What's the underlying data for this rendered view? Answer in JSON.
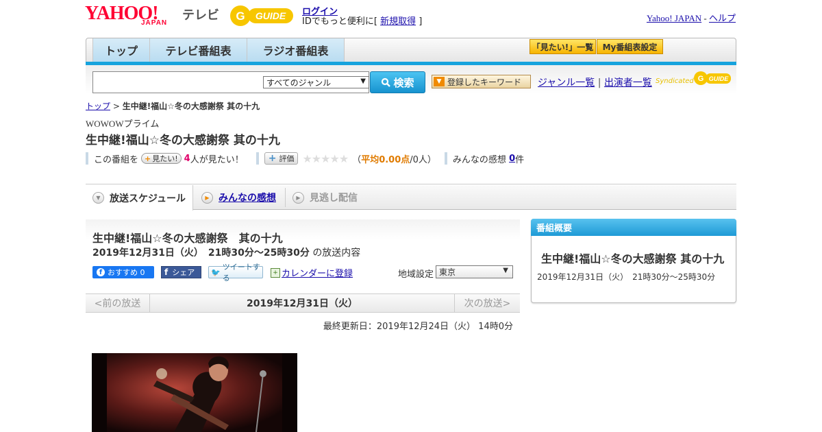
{
  "header": {
    "logo_text": "YAHOO!",
    "logo_sub": "JAPAN",
    "service_name": "テレビ",
    "guide_logo": "G-GUIDE",
    "login_label": "ログイン",
    "login_sub_prefix": "IDでもっと便利に[",
    "signup_label": "新規取得",
    "login_sub_suffix": "]",
    "yahoo_japan_link": "Yahoo! JAPAN",
    "separator": " - ",
    "help_link": "ヘルプ"
  },
  "nav": {
    "tabs": [
      "トップ",
      "テレビ番組表",
      "ラジオ番組表"
    ],
    "buttons": [
      "「見たい!」一覧",
      "My番組表設定"
    ]
  },
  "search": {
    "query_value": "",
    "genre_selected": "すべてのジャンル",
    "search_button": "検索",
    "keyword_button": "登録したキーワード",
    "genre_list_link": "ジャンル一覧",
    "link_separator": " | ",
    "performer_list_link": "出演者一覧",
    "syndicated_label": "Syndicated"
  },
  "breadcrumb": {
    "home": "トップ",
    "separator": " > ",
    "current": "生中継!福山☆冬の大感謝祭 其の十九"
  },
  "program": {
    "channel": "WOWOWプライム",
    "title": "生中継!福山☆冬の大感謝祭 其の十九",
    "stats": {
      "this_program_label": "この番組を",
      "mitai_button": "見たい!",
      "mitai_count": "4",
      "mitai_suffix": "人が見たい！",
      "hyoka_button": "評価",
      "stars": "★★★★★",
      "rating_open": "（",
      "rating_avg": "平均0.00点",
      "rating_people": "/0人）",
      "kansou_label": "みんなの感想",
      "kansou_count": "0",
      "kansou_unit": "件"
    }
  },
  "tabs": [
    "放送スケジュール",
    "みんなの感想",
    "見逃し配信"
  ],
  "main": {
    "title": "生中継!福山☆冬の大感謝祭　其の十九",
    "date": "2019年12月31日（火）　21時30分～25時30分",
    "date_suffix": "の放送内容",
    "fb_button": "おすすめ 0",
    "share_button": "シェア",
    "tweet_button": "ツイートする",
    "calendar_link": "カレンダーに登録",
    "region_label": "地域設定",
    "region_selected": "東京",
    "pager_prev": "<前の放送",
    "pager_date": "2019年12月31日（火）",
    "pager_next": "次の放送>",
    "updated": "最終更新日：2019年12月24日（火） 14時0分"
  },
  "sidebar": {
    "header": "番組概要",
    "title": "生中継!福山☆冬の大感謝祭 其の十九",
    "date": "2019年12月31日（火）　21時30分～25時30分"
  },
  "colors": {
    "accent_blue": "#16a3dd",
    "yahoo_red": "#ff0033",
    "guide_yellow": "#f7c600",
    "mitai_count": "#e0006a",
    "rating_orange": "#e07b00"
  },
  "icons": [
    "search-icon",
    "plus-icon",
    "star-icon",
    "facebook-icon",
    "twitter-icon",
    "calendar-icon",
    "chevron-down-icon"
  ]
}
